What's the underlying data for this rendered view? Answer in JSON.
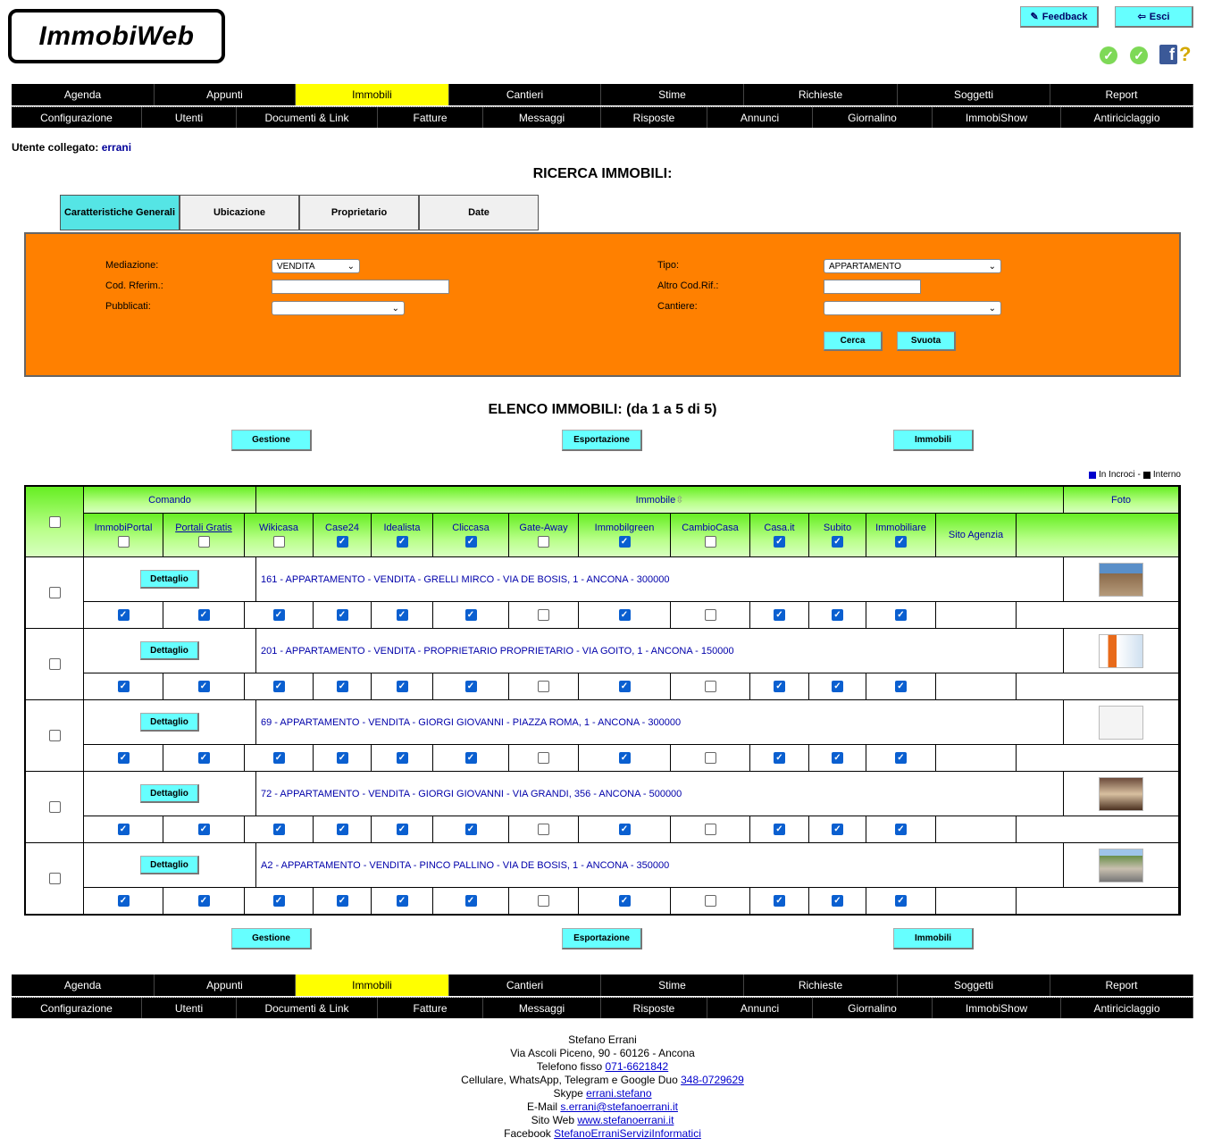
{
  "app": {
    "logo": "ImmobiWeb"
  },
  "top_buttons": {
    "feedback": "Feedback",
    "exit": "Esci"
  },
  "menu": {
    "row1": [
      "Agenda",
      "Appunti",
      "Immobili",
      "Cantieri",
      "Stime",
      "Richieste",
      "Soggetti",
      "Report"
    ],
    "row2": [
      "Configurazione",
      "Utenti",
      "Documenti & Link",
      "Fatture",
      "Messaggi",
      "Risposte",
      "Annunci",
      "Giornalino",
      "ImmobiShow",
      "Antiriciclaggio"
    ],
    "active": "Immobili"
  },
  "user": {
    "label": "Utente collegato:",
    "name": "errani"
  },
  "search": {
    "title": "RICERCA IMMOBILI:",
    "tabs": [
      "Caratteristiche Generali",
      "Ubicazione",
      "Proprietario",
      "Date"
    ],
    "fields": {
      "mediazione_label": "Mediazione:",
      "mediazione_value": "VENDITA",
      "codrif_label": "Cod. Rferim.:",
      "codrif_value": "",
      "pubblicati_label": "Pubblicati:",
      "pubblicati_value": "",
      "tipo_label": "Tipo:",
      "tipo_value": "APPARTAMENTO",
      "altrocod_label": "Altro Cod.Rif.:",
      "altrocod_value": "",
      "cantiere_label": "Cantiere:",
      "cantiere_value": ""
    },
    "buttons": {
      "search": "Cerca",
      "clear": "Svuota"
    }
  },
  "list": {
    "title": "ELENCO IMMOBILI: (da 1 a 5 di 5)",
    "actions": {
      "manage": "Gestione",
      "export": "Esportazione",
      "properties": "Immobili"
    },
    "legend": {
      "cross": "In Incroci",
      "sep": "-",
      "internal": "Interno",
      "cross_color": "#0000cc",
      "internal_color": "#000000"
    },
    "header": {
      "command": "Comando",
      "property": "Immobile",
      "sort_icon": "sort-arrows-icon",
      "photo": "Foto"
    },
    "portals": [
      "ImmobiPortal",
      "Portali Gratis",
      "Wikicasa",
      "Case24",
      "Idealista",
      "Cliccasa",
      "Gate-Away",
      "Immobilgreen",
      "CambioCasa",
      "Casa.it",
      "Subito",
      "Immobiliare",
      "Sito Agenzia"
    ],
    "header_checks": [
      false,
      false,
      false,
      true,
      true,
      true,
      false,
      true,
      false,
      true,
      true,
      true
    ],
    "detail_label": "Dettaglio",
    "rows": [
      {
        "description": "161 - APPARTAMENTO - VENDITA - GRELLI MIRCO - VIA DE BOSIS, 1 - ANCONA - 300000",
        "checks": [
          true,
          true,
          true,
          true,
          true,
          true,
          false,
          true,
          false,
          true,
          true,
          true
        ],
        "photo": "building-photo"
      },
      {
        "description": "201 - APPARTAMENTO - VENDITA - PROPRIETARIO PROPRIETARIO - VIA GOITO, 1 - ANCONA - 150000",
        "checks": [
          true,
          true,
          true,
          true,
          true,
          true,
          false,
          true,
          false,
          true,
          true,
          true
        ],
        "photo": "flyer-photo"
      },
      {
        "description": "69 - APPARTAMENTO - VENDITA - GIORGI GIOVANNI - PIAZZA ROMA, 1 - ANCONA - 300000",
        "checks": [
          true,
          true,
          true,
          true,
          true,
          true,
          false,
          true,
          false,
          true,
          true,
          true
        ],
        "photo": "floorplan-photo"
      },
      {
        "description": "72 - APPARTAMENTO - VENDITA - GIORGI GIOVANNI - VIA GRANDI, 356 - ANCONA - 500000",
        "checks": [
          true,
          true,
          true,
          true,
          true,
          true,
          false,
          true,
          false,
          true,
          true,
          true
        ],
        "photo": "interior-photo"
      },
      {
        "description": "A2 - APPARTAMENTO - VENDITA - PINCO PALLINO - VIA DE BOSIS, 1 - ANCONA - 350000",
        "checks": [
          true,
          true,
          true,
          true,
          true,
          true,
          false,
          true,
          false,
          true,
          true,
          true
        ],
        "photo": "exterior-photo"
      }
    ]
  },
  "footer": {
    "name": "Stefano Errani",
    "address": "Via Ascoli Piceno, 90 - 60126 - Ancona",
    "phone_label": "Telefono fisso",
    "phone": "071-6621842",
    "mobile_label": "Cellulare, WhatsApp, Telegram e Google Duo",
    "mobile": "348-0729629",
    "skype_label": "Skype",
    "skype": "errani.stefano",
    "email_label": "E-Mail",
    "email": "s.errani@stefanoerrani.it",
    "web_label": "Sito Web",
    "web": "www.stefanoerrani.it",
    "facebook_label": "Facebook",
    "facebook": "StefanoErraniServiziInformatici"
  },
  "colors": {
    "accent": "#66ffff",
    "search_bg": "#ff8000",
    "menu_active": "#ffff00",
    "grid_header": "#66ee22"
  }
}
